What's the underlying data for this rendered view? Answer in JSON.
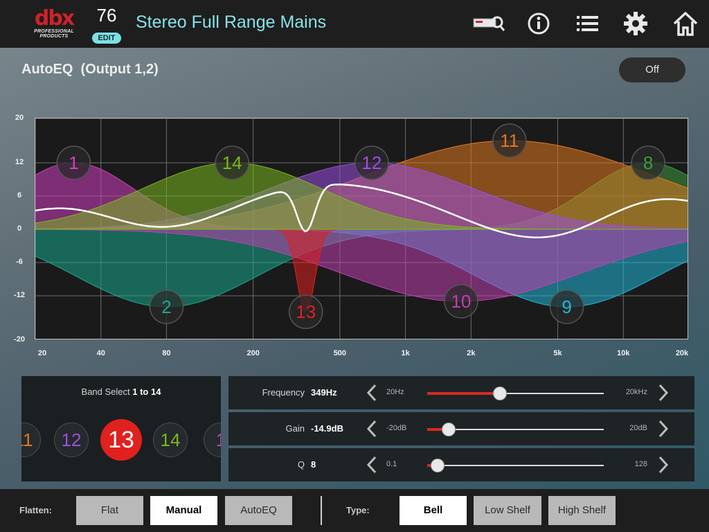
{
  "header": {
    "logo_text": "dbx",
    "logo_subtext": "PROFESSIONAL PRODUCTS",
    "preset_number": "76",
    "edit_label": "EDIT",
    "preset_name": "Stereo Full Range Mains",
    "icons": [
      "device-wizard-icon",
      "info-icon",
      "list-icon",
      "gear-icon",
      "home-icon"
    ]
  },
  "title": {
    "text": "AutoEQ  (Output 1,2)",
    "toggle_label": "Off"
  },
  "graph": {
    "y_ticks": [
      "20",
      "12",
      "6",
      "0",
      "-6",
      "-12",
      "-20"
    ],
    "x_ticks": [
      "20",
      "40",
      "80",
      "200",
      "500",
      "1k",
      "2k",
      "5k",
      "10k",
      "20k"
    ],
    "y_range_db": [
      -20,
      20
    ],
    "x_range_hz": [
      20,
      20000
    ],
    "x_scale": "log",
    "grid": true,
    "bands": [
      {
        "num": "1",
        "freq": 30,
        "gain": 12,
        "q": 1.2,
        "color": "#d040c0"
      },
      {
        "num": "2",
        "freq": 80,
        "gain": -14,
        "q": 0.8,
        "color": "#1aa88c"
      },
      {
        "num": "8",
        "freq": 13000,
        "gain": 12,
        "q": 1.2,
        "color": "#3f9a40"
      },
      {
        "num": "9",
        "freq": 5500,
        "gain": -14,
        "q": 0.8,
        "color": "#20b8d8"
      },
      {
        "num": "10",
        "freq": 1800,
        "gain": -13,
        "q": 0.6,
        "color": "#c040b0"
      },
      {
        "num": "11",
        "freq": 3000,
        "gain": 16,
        "q": 0.5,
        "color": "#e07820"
      },
      {
        "num": "12",
        "freq": 700,
        "gain": 12,
        "q": 0.7,
        "color": "#9a50e0"
      },
      {
        "num": "13",
        "freq": 349,
        "gain": -14.9,
        "q": 8,
        "color": "#e02020"
      },
      {
        "num": "14",
        "freq": 160,
        "gain": 12,
        "q": 0.8,
        "color": "#7ab820"
      }
    ]
  },
  "band_select": {
    "label_prefix": "Band Select",
    "label_range": "1 to 14",
    "chips": [
      {
        "num": "11",
        "color": "#e07820"
      },
      {
        "num": "12",
        "color": "#9a50e0"
      },
      {
        "num": "13",
        "color": "#ffffff",
        "selected": true
      },
      {
        "num": "14",
        "color": "#7ab820"
      },
      {
        "num": "1",
        "color": "#d040c0"
      }
    ]
  },
  "params": {
    "frequency": {
      "label": "Frequency",
      "value": "349Hz",
      "min": "20Hz",
      "max": "20kHz",
      "level": 0.41
    },
    "gain": {
      "label": "Gain",
      "value": "-14.9dB",
      "min": "-20dB",
      "max": "20dB",
      "level": 0.12
    },
    "q": {
      "label": "Q",
      "value": "8",
      "min": "0.1",
      "max": "128",
      "level": 0.06
    }
  },
  "footer": {
    "flatten_label": "Flatten:",
    "flatten_options": [
      "Flat",
      "Manual",
      "AutoEQ"
    ],
    "flatten_active": "Manual",
    "type_label": "Type:",
    "type_options": [
      "Bell",
      "Low Shelf",
      "High Shelf"
    ],
    "type_active": "Bell"
  },
  "colors": {
    "accent_red": "#d52a23",
    "title_cyan": "#86e3ea",
    "edit_badge": "#7fe0e4"
  }
}
